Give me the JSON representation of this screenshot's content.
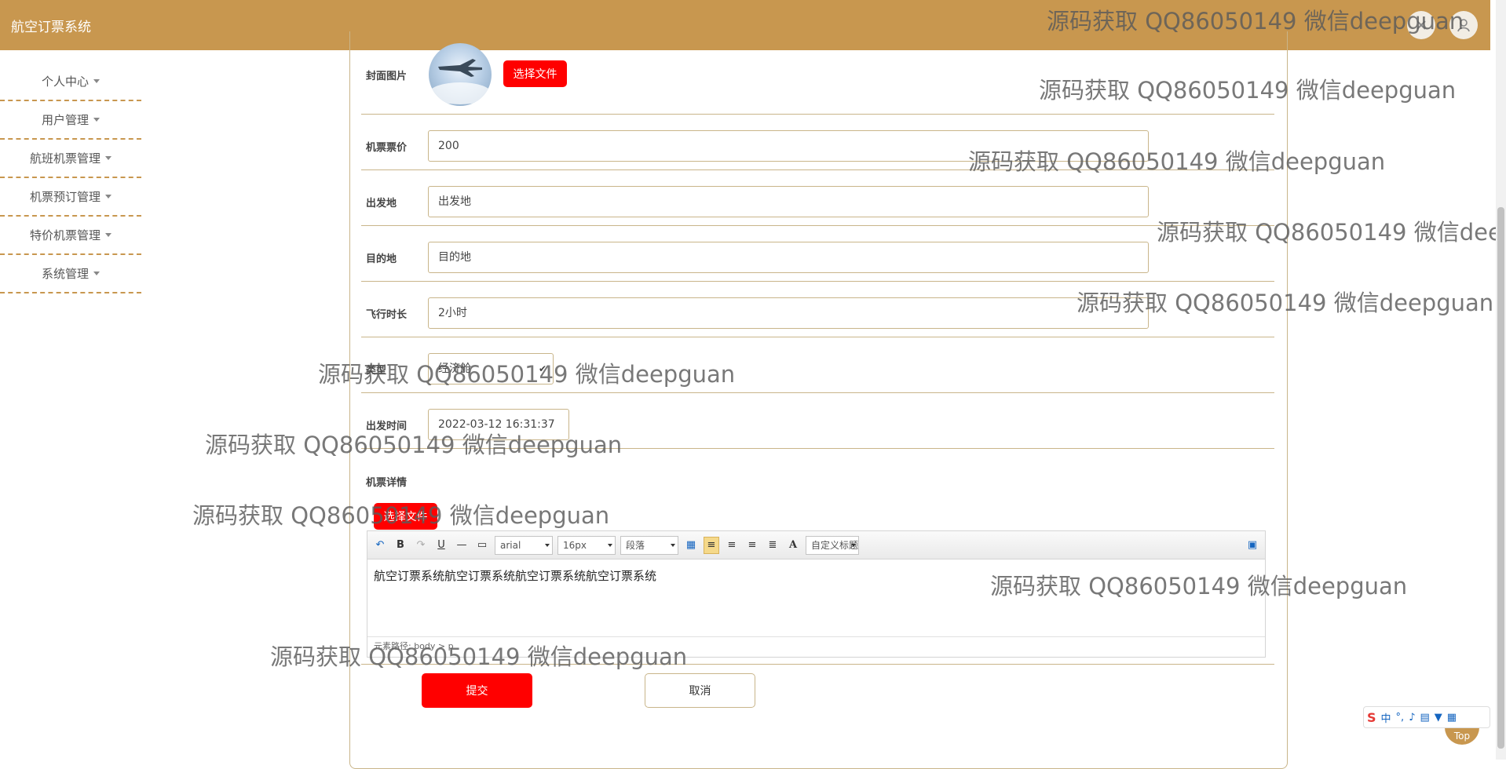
{
  "header": {
    "title": "航空订票系统"
  },
  "sidebar": {
    "items": [
      {
        "label": "个人中心"
      },
      {
        "label": "用户管理"
      },
      {
        "label": "航班机票管理"
      },
      {
        "label": "机票预订管理"
      },
      {
        "label": "特价机票管理"
      },
      {
        "label": "系统管理"
      }
    ]
  },
  "form": {
    "cover": {
      "label": "封面图片",
      "button": "选择文件"
    },
    "price": {
      "label": "机票票价",
      "value": "200"
    },
    "departure": {
      "label": "出发地",
      "value": "出发地"
    },
    "destination": {
      "label": "目的地",
      "value": "目的地"
    },
    "duration": {
      "label": "飞行时长",
      "value": "2小时"
    },
    "type": {
      "label": "类型",
      "value": "经济舱"
    },
    "departure_time": {
      "label": "出发时间",
      "value": "2022-03-12 16:31:37"
    },
    "details": {
      "label": "机票详情",
      "upload_button": "选择文件",
      "toolbar": {
        "font": "arial",
        "size": "16px",
        "paragraph": "段落",
        "custom_heading": "自定义标题"
      },
      "content": "航空订票系统航空订票系统航空订票系统航空订票系统",
      "footer": "元素路径: body > p"
    },
    "submit": "提交",
    "cancel": "取消"
  },
  "watermark": "源码获取 QQ86050149 微信deepguan",
  "ime": {
    "mode": "中",
    "punct": "°,"
  },
  "to_top": "Top",
  "colors": {
    "header": "#c8974f",
    "primary_button": "#ff0000",
    "border": "#c9b58a"
  }
}
